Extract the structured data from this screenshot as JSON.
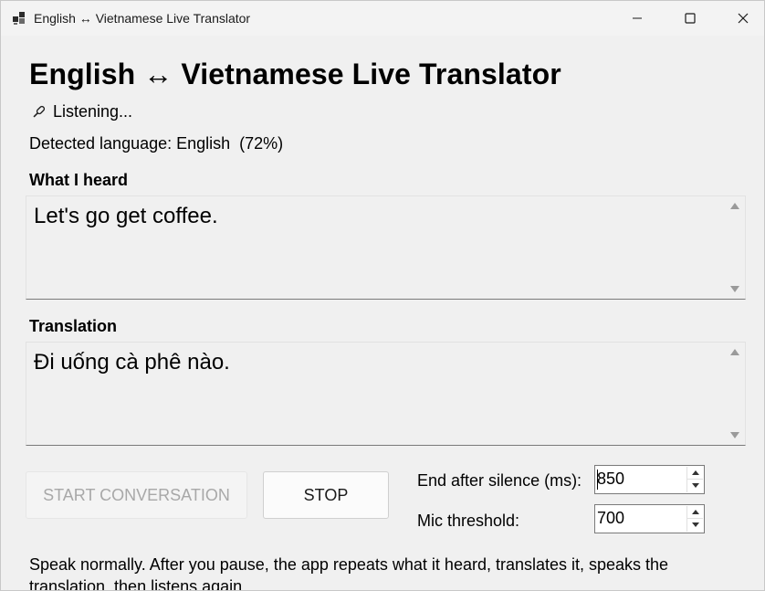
{
  "window": {
    "title": "English ↔ Vietnamese Live Translator",
    "minimize_icon": "minimize-icon",
    "maximize_icon": "maximize-icon",
    "close_icon": "close-icon"
  },
  "header": {
    "title": "English ↔ Vietnamese Live Translator",
    "status_icon": "microphone-icon",
    "status": "Listening...",
    "detected_language": "Detected language: English  (72%)"
  },
  "heard": {
    "label": "What I heard",
    "text": "Let's go get coffee."
  },
  "translation": {
    "label": "Translation",
    "text": "Đi uống cà phê nào."
  },
  "controls": {
    "start_label": "START CONVERSATION",
    "stop_label": "STOP",
    "silence_label": "End after silence (ms):",
    "silence_value": "850",
    "threshold_label": "Mic threshold:",
    "threshold_value": "700"
  },
  "help_text": "Speak normally. After you pause, the app repeats what it heard, translates it, speaks the translation, then listens again."
}
